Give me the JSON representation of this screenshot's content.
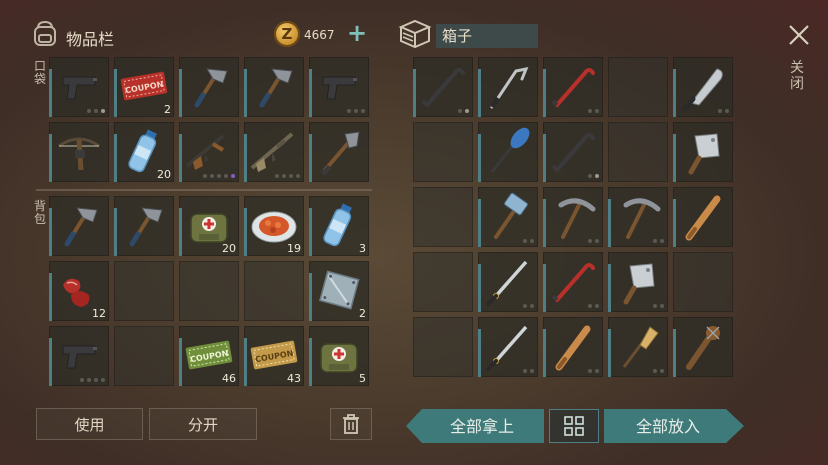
{
  "header": {
    "inventory_title": "物品栏",
    "coin_symbol": "Z",
    "coin_amount": "4667",
    "add_label": "+",
    "box_name": "箱子",
    "close_label": "关闭"
  },
  "sections": {
    "pocket_label": "口袋",
    "backpack_label": "背包"
  },
  "inventory": {
    "pocket": [
      {
        "icon": "pistol-icon",
        "qty": "",
        "dots": [
          0,
          0,
          1
        ]
      },
      {
        "icon": "coupon-red-icon",
        "qty": "2",
        "dots": []
      },
      {
        "icon": "hatchet-icon",
        "qty": "",
        "dots": []
      },
      {
        "icon": "hatchet-icon",
        "qty": "",
        "dots": []
      },
      {
        "icon": "pistol-icon",
        "qty": "",
        "dots": [
          0,
          0,
          0
        ]
      },
      {
        "icon": "crossbow-icon",
        "qty": "",
        "dots": []
      },
      {
        "icon": "water-bottle-icon",
        "qty": "20",
        "dots": []
      },
      {
        "icon": "assault-rifle-icon",
        "qty": "",
        "dots": [
          0,
          0,
          0,
          0,
          2
        ]
      },
      {
        "icon": "rifle-icon",
        "qty": "",
        "dots": [
          0,
          0,
          0,
          0
        ]
      },
      {
        "icon": "shovel-icon",
        "qty": "",
        "dots": []
      }
    ],
    "backpack": [
      {
        "icon": "hatchet-icon",
        "qty": "",
        "dots": []
      },
      {
        "icon": "hatchet-icon",
        "qty": "",
        "dots": []
      },
      {
        "icon": "medkit-bag-icon",
        "qty": "20",
        "dots": []
      },
      {
        "icon": "food-plate-icon",
        "qty": "19",
        "dots": []
      },
      {
        "icon": "water-bottle-icon",
        "qty": "3",
        "dots": []
      },
      {
        "icon": "raw-meat-icon",
        "qty": "12",
        "dots": []
      },
      {
        "icon": "",
        "qty": "",
        "dots": []
      },
      {
        "icon": "",
        "qty": "",
        "dots": []
      },
      {
        "icon": "",
        "qty": "",
        "dots": []
      },
      {
        "icon": "metal-plate-icon",
        "qty": "2",
        "dots": []
      },
      {
        "icon": "pistol-icon",
        "qty": "",
        "dots": [
          0,
          0,
          0,
          0
        ]
      },
      {
        "icon": "",
        "qty": "",
        "dots": []
      },
      {
        "icon": "coupon-green-icon",
        "qty": "46",
        "dots": []
      },
      {
        "icon": "coupon-gold-icon",
        "qty": "43",
        "dots": []
      },
      {
        "icon": "medkit-bag-icon",
        "qty": "5",
        "dots": []
      }
    ]
  },
  "box": {
    "slots": [
      {
        "icon": "crowbar-icon",
        "qty": "",
        "dots": [
          0,
          1
        ]
      },
      {
        "icon": "hook-icon",
        "qty": "",
        "dots": []
      },
      {
        "icon": "crowbar-red-icon",
        "qty": "",
        "dots": [
          0,
          0
        ]
      },
      {
        "icon": "",
        "qty": "",
        "dots": []
      },
      {
        "icon": "machete-icon",
        "qty": "",
        "dots": [
          0,
          0
        ]
      },
      {
        "icon": "",
        "qty": "",
        "dots": []
      },
      {
        "icon": "paddle-icon",
        "qty": "",
        "dots": []
      },
      {
        "icon": "crowbar-icon",
        "qty": "",
        "dots": [
          0,
          1
        ]
      },
      {
        "icon": "",
        "qty": "",
        "dots": []
      },
      {
        "icon": "cleaver-icon",
        "qty": "",
        "dots": []
      },
      {
        "icon": "",
        "qty": "",
        "dots": []
      },
      {
        "icon": "sledgehammer-icon",
        "qty": "",
        "dots": [
          0,
          0
        ]
      },
      {
        "icon": "pickaxe-icon",
        "qty": "",
        "dots": [
          0,
          0
        ]
      },
      {
        "icon": "pickaxe-icon",
        "qty": "",
        "dots": [
          0,
          0
        ]
      },
      {
        "icon": "baseball-bat-icon",
        "qty": "",
        "dots": []
      },
      {
        "icon": "",
        "qty": "",
        "dots": []
      },
      {
        "icon": "katana-icon",
        "qty": "",
        "dots": [
          0,
          0
        ]
      },
      {
        "icon": "crowbar-red-icon",
        "qty": "",
        "dots": [
          0,
          0
        ]
      },
      {
        "icon": "cleaver-icon",
        "qty": "",
        "dots": [
          0,
          0
        ]
      },
      {
        "icon": "",
        "qty": "",
        "dots": []
      },
      {
        "icon": "",
        "qty": "",
        "dots": []
      },
      {
        "icon": "katana-icon",
        "qty": "",
        "dots": [
          0,
          0
        ]
      },
      {
        "icon": "baseball-bat-icon",
        "qty": "",
        "dots": [
          0,
          0
        ]
      },
      {
        "icon": "broom-icon",
        "qty": "",
        "dots": [
          0,
          0
        ]
      },
      {
        "icon": "spiked-club-icon",
        "qty": "",
        "dots": []
      }
    ]
  },
  "buttons": {
    "use": "使用",
    "split": "分开",
    "take_all": "全部拿上",
    "put_all": "全部放入"
  },
  "colors": {
    "accent_teal": "#3f7a7a",
    "slot_bar": "#4e7e86",
    "coin_gold": "#d9a441"
  }
}
